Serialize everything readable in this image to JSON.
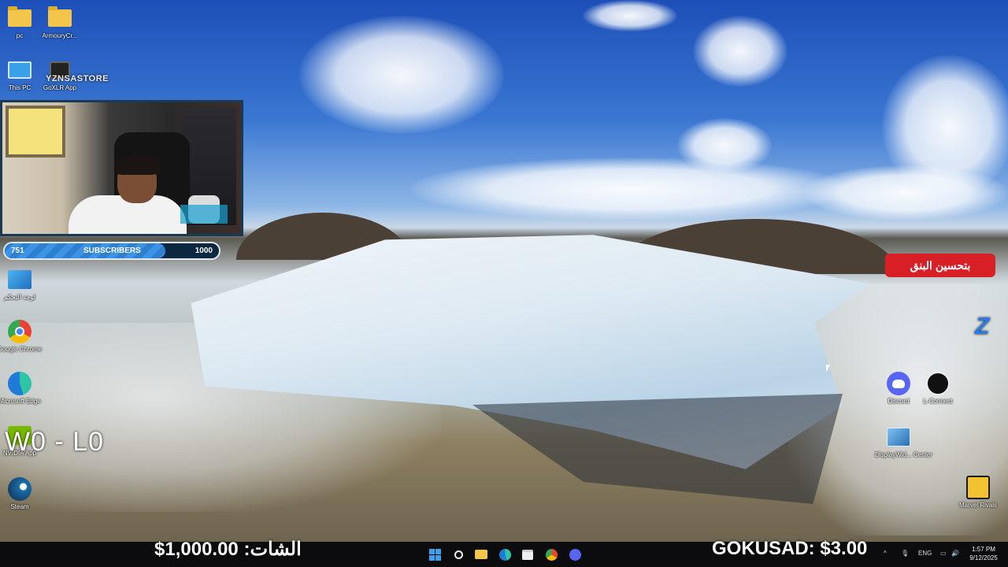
{
  "desktop": {
    "icons": [
      {
        "label": "pc",
        "icon": "folder-icon"
      },
      {
        "label": "ArmouryCr...",
        "icon": "folder-icon"
      },
      {
        "label": "This PC",
        "icon": "monitor-icon"
      },
      {
        "label": "GoXLR App",
        "icon": "goxlr-icon"
      },
      {
        "label": "لوحة التحكم",
        "icon": "control-panel-icon"
      },
      {
        "label": "Google Chrome",
        "icon": "chrome-icon"
      },
      {
        "label": "Microsoft Edge",
        "icon": "edge-icon"
      },
      {
        "label": "NVIDIA App",
        "icon": "nvidia-icon"
      },
      {
        "label": "Steam",
        "icon": "steam-icon"
      },
      {
        "label": "Discord",
        "icon": "discord-icon"
      },
      {
        "label": "L-Connect",
        "icon": "lconnect-icon"
      },
      {
        "label": "DisplayWid... Center",
        "icon": "display-widget-icon"
      },
      {
        "label": "Marvel Rivals",
        "icon": "marvel-rivals-icon"
      }
    ]
  },
  "overlay": {
    "brand": "YZNSASTORE",
    "subscribers": {
      "current": "751",
      "label": "SUBSCRIBERS",
      "goal": "1000",
      "progress": 0.751
    },
    "score": "W0 - L0",
    "red_tag": "بتحسين البنق",
    "logo_letter": "Z",
    "ticker_left": "الشات: 1,000.00$",
    "ticker_right": "GOKUSAD: $3.00"
  },
  "taskbar": {
    "apps": [
      "windows-start-icon",
      "search-icon",
      "file-explorer-icon",
      "edge-icon",
      "store-icon",
      "chrome-icon",
      "discord-icon"
    ],
    "tray": {
      "language": "ENG"
    },
    "clock": {
      "time": "1:57 PM",
      "date": "9/12/2025"
    }
  },
  "colors": {
    "accent": "#d81f26",
    "progress": "#3d93e6",
    "taskbar": "#0c0c0e"
  }
}
